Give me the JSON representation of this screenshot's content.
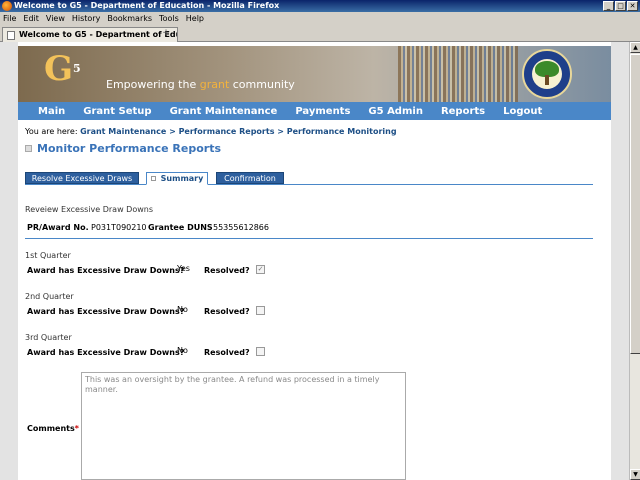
{
  "window": {
    "title": "Welcome to G5 - Department of Education - Mozilla Firefox",
    "buttons": [
      "_",
      "□",
      "✕"
    ]
  },
  "menu": [
    "File",
    "Edit",
    "View",
    "History",
    "Bookmarks",
    "Tools",
    "Help"
  ],
  "browser_tab": {
    "label": "Welcome to G5 - Department of Educ...",
    "new_tab": "+"
  },
  "banner": {
    "logo_text": "G",
    "logo_sup": "5",
    "tagline_pre": "Empowering the ",
    "tagline_highlight": "grant",
    "tagline_post": " community"
  },
  "nav": [
    "Main",
    "Grant Setup",
    "Grant Maintenance",
    "Payments",
    "G5 Admin",
    "Reports",
    "Logout"
  ],
  "breadcrumb": {
    "prefix": "You are here: ",
    "path": "Grant Maintenance > Performance Reports > Performance Monitoring"
  },
  "page_title": "Monitor Performance Reports",
  "subtabs": [
    {
      "label": "Resolve Excessive Draws",
      "active": false
    },
    {
      "label": "Summary",
      "active": true
    },
    {
      "label": "Confirmation",
      "active": false
    }
  ],
  "review": {
    "heading": "Reveiew Excessive Draw Downs",
    "award_label": "PR/Award No.",
    "award_value": "P031T090210",
    "duns_label": "Grantee DUNS",
    "duns_value": "55355612866"
  },
  "quarters": [
    {
      "name": "1st Quarter",
      "question": "Award has Excessive Draw Downs?",
      "answer": "Yes",
      "resolved_label": "Resolved?",
      "resolved": true
    },
    {
      "name": "2nd Quarter",
      "question": "Award has Excessive Draw Downs?",
      "answer": "No",
      "resolved_label": "Resolved?",
      "resolved": false
    },
    {
      "name": "3rd Quarter",
      "question": "Award has Excessive Draw Downs?",
      "answer": "No",
      "resolved_label": "Resolved?",
      "resolved": false
    }
  ],
  "comments": {
    "label": "Comments",
    "required_mark": "*",
    "value": "This was an oversight by the grantee.  A refund was processed in a timely manner."
  },
  "colors": {
    "nav": "#4a87c8",
    "title": "#3a73b8",
    "tab_dark": "#2d5f9e"
  }
}
